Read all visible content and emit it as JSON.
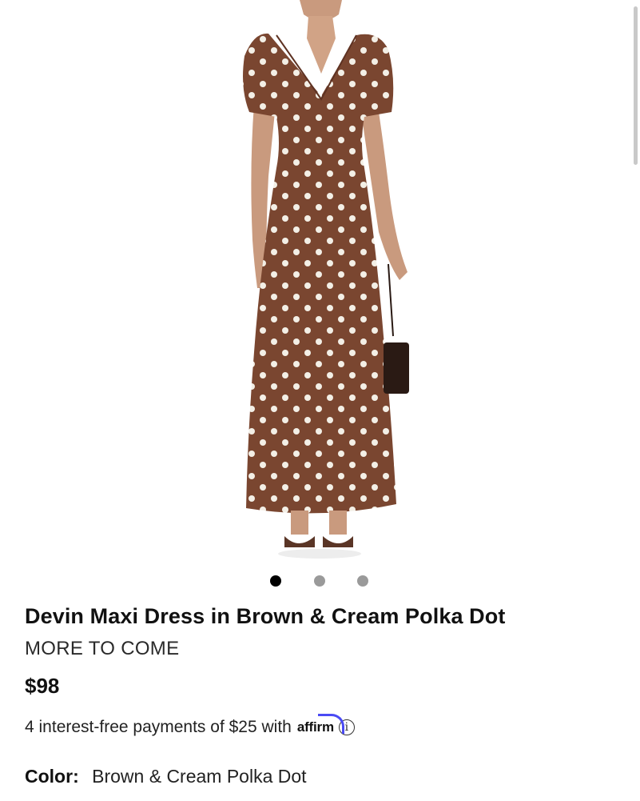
{
  "product": {
    "title": "Devin Maxi Dress in Brown & Cream Polka Dot",
    "brand": "MORE TO COME",
    "price": "$98",
    "payments": {
      "text": "4 interest-free payments of $25 with",
      "provider": "affirm"
    },
    "color": {
      "label": "Color",
      "separator": ":",
      "value": "Brown & Cream Polka Dot"
    }
  },
  "gallery": {
    "image_icon": "dress-product-photo",
    "total": 3,
    "active_index": 1
  },
  "colors": {
    "dress": "#7a4630",
    "dots": "#f3efe6",
    "accent_affirm": "#4a4af4",
    "dot_active": "#000000",
    "dot_inactive": "#9a9a9a"
  },
  "icons": {
    "info": "info-icon"
  }
}
